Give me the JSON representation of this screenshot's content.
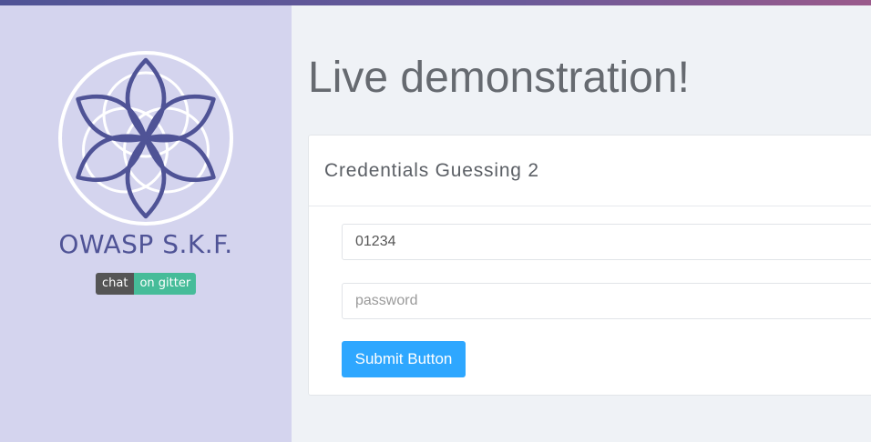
{
  "brand": {
    "name": "OWASP S.K.F.",
    "logo_icon": "flower-of-life-icon",
    "logo_color": "#4f5396"
  },
  "badge": {
    "left_label": "chat",
    "right_label": "on gitter",
    "left_color": "#555555",
    "right_color": "#46bc99"
  },
  "main": {
    "title": "Live demonstration!",
    "card": {
      "title": "Credentials Guessing 2",
      "username_value": "01234",
      "password_placeholder": "password",
      "submit_label": "Submit Button"
    }
  },
  "colors": {
    "sidebar_bg": "#d4d4ee",
    "page_bg": "#eff2f6",
    "button": "#2ea7ff"
  }
}
